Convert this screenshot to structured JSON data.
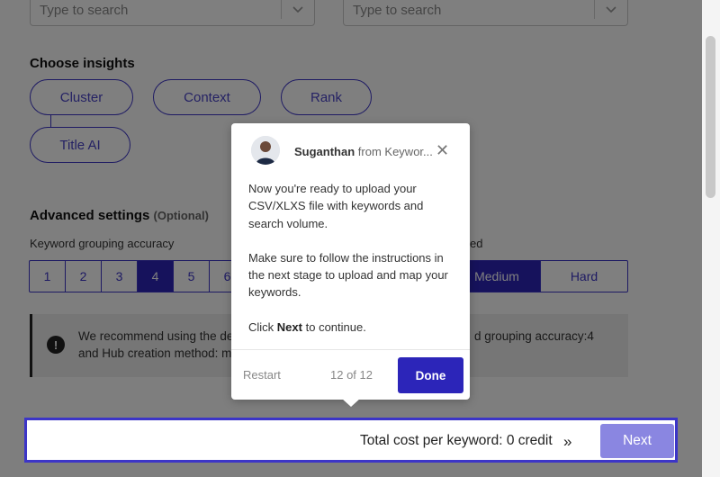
{
  "search_selects": [
    {
      "placeholder": "Type to search"
    },
    {
      "placeholder": "Type to search"
    }
  ],
  "insights": {
    "heading": "Choose insights",
    "chips": [
      "Cluster",
      "Context",
      "Rank",
      "Title AI"
    ]
  },
  "advanced": {
    "heading": "Advanced settings",
    "optional": "(Optional)",
    "accuracy_label": "Keyword grouping accuracy",
    "accuracy_options": [
      "1",
      "2",
      "3",
      "4",
      "5",
      "6"
    ],
    "accuracy_selected": "4",
    "method_label_fragment": "ed",
    "method_options": [
      "Medium",
      "Hard"
    ],
    "method_selected": "Medium"
  },
  "info": {
    "line1_left": "We recommend using the de",
    "line1_right": "d grouping accuracy:4",
    "line2": "and Hub creation method: m"
  },
  "footer": {
    "cost_label": "Total cost per keyword: 0 credit",
    "arrows": "»",
    "next_label": "Next"
  },
  "tour": {
    "sender_name": "Suganthan",
    "sender_suffix": "from Keywor...",
    "paragraph1": "Now you're ready to upload your CSV/XLXS file with keywords and search volume.",
    "paragraph2": "Make sure to follow the instructions in the next stage to upload and map your keywords.",
    "click_prefix": "Click",
    "click_bold": "Next",
    "click_suffix": "to continue.",
    "restart_label": "Restart",
    "step_counter": "12 of 12",
    "done_label": "Done"
  },
  "colors": {
    "accent": "#3c35c7",
    "accent_active": "#2c25b9",
    "next_disabled": "#8a86e1",
    "overlay": "rgba(0,0,0,0.5)"
  }
}
